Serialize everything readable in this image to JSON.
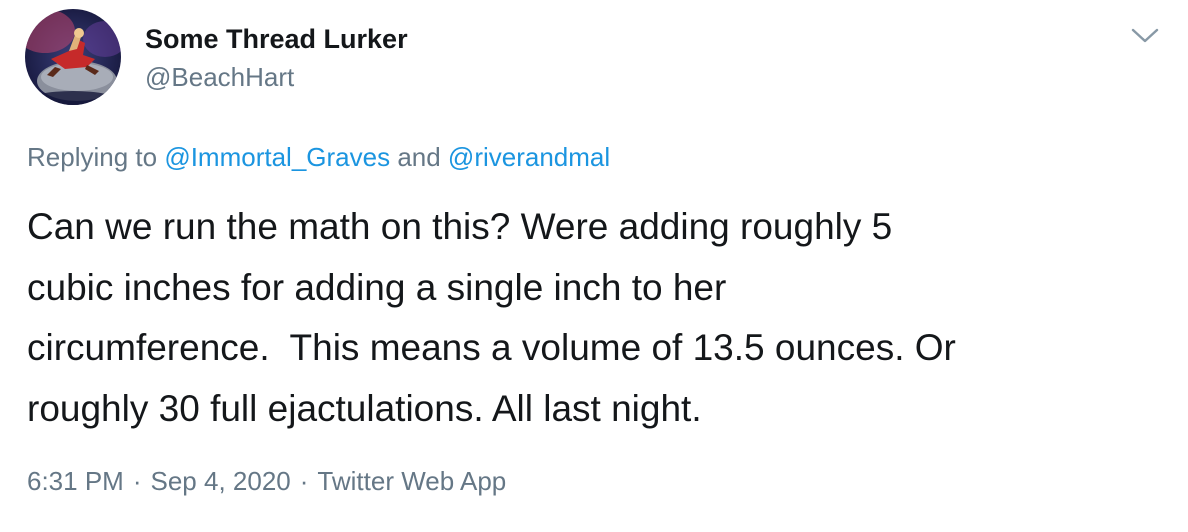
{
  "author": {
    "name": "Some Thread Lurker",
    "handle": "@BeachHart"
  },
  "reply": {
    "prefix": "Replying to ",
    "mention_1": "@Immortal_Graves",
    "joiner": " and ",
    "mention_2": "@riverandmal"
  },
  "tweet": {
    "text": "Can we run the math on this? Were adding roughly 5\ncubic inches for adding a single inch to her\ncircumference.  This means a volume of 13.5 ounces. Or\nroughly 30 full ejactulations. All last night."
  },
  "meta": {
    "time": "6:31 PM",
    "separator": "·",
    "date": "Sep 4, 2020",
    "source": "Twitter Web App"
  },
  "icons": {
    "menu": "chevron-down-icon",
    "avatar": "profile-avatar"
  },
  "colors": {
    "text": "#14171a",
    "secondary": "#657786",
    "link": "#1b95e0"
  }
}
